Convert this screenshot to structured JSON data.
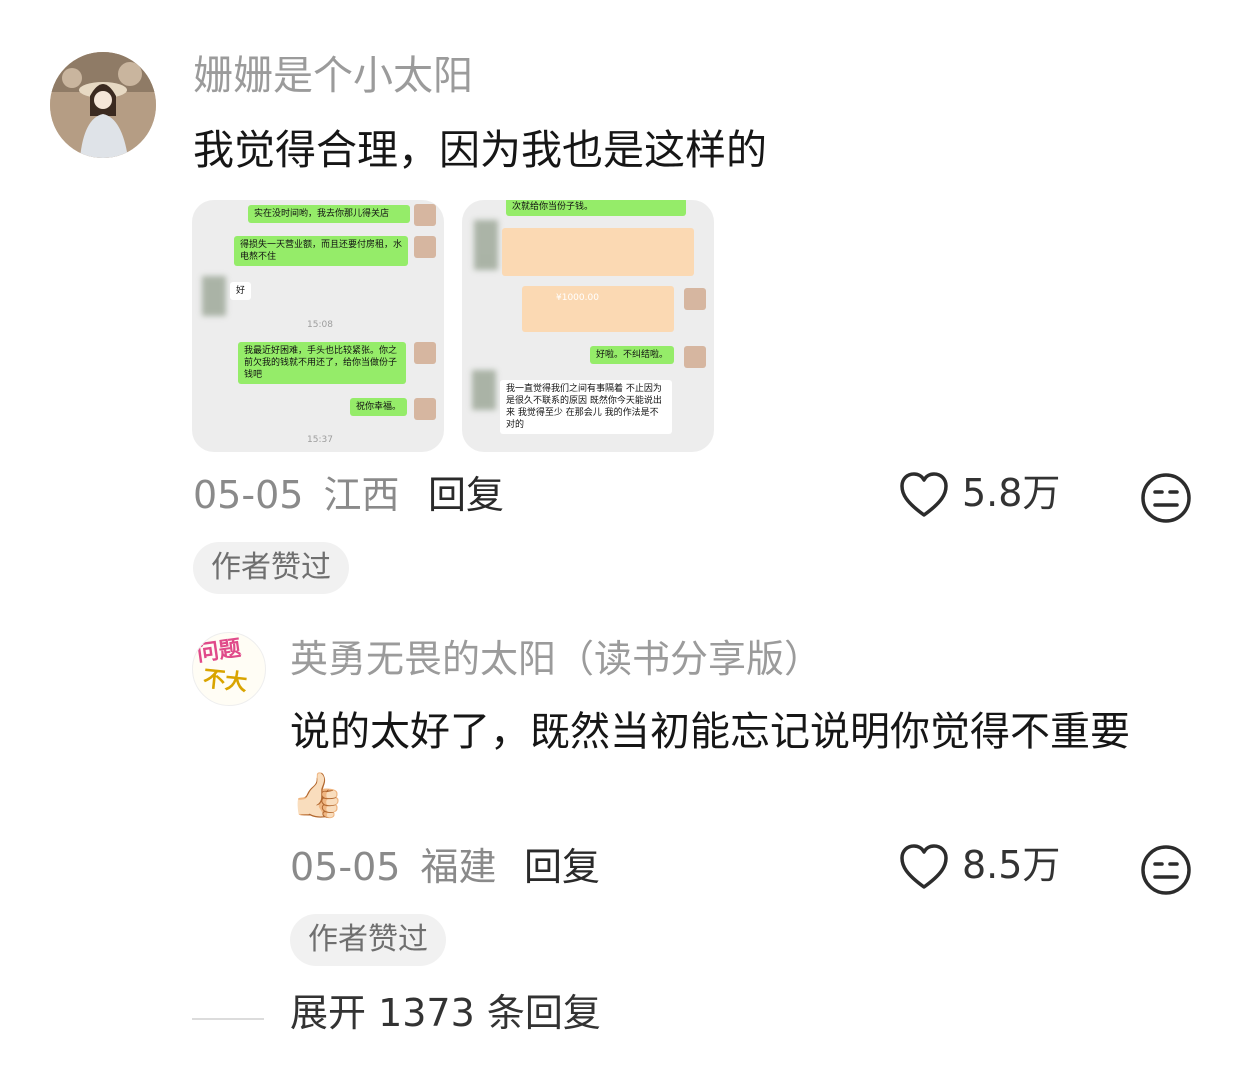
{
  "comments": [
    {
      "username": "姗姗是个小太阳",
      "text": "我觉得合理，因为我也是这样的",
      "date": "05-05",
      "location": "江西",
      "reply_label": "回复",
      "likes": "5.8万",
      "badge": "作者赞过",
      "images": [
        {
          "messages": [
            "实在没时间哟，我去你那儿得关店",
            "得损失一天营业额，而且还要付房租，水电熬不住",
            "好",
            "15:08",
            "我最近好困难，手头也比较紧张。你之前欠我的钱就不用还了，给你当做份子钱吧",
            "祝你幸福。",
            "15:37"
          ]
        },
        {
          "messages": [
            "次就给你当份子钱。",
            "¥1000.00",
            "好啦。不纠结啦。",
            "我一直觉得我们之间有事隔着 不止因为是很久不联系的原因 既然你今天能说出来 我觉得至少 在那会儿 我的作法是不对的"
          ]
        }
      ]
    },
    {
      "username": "英勇无畏的太阳（读书分享版）",
      "avatar_text": [
        "问题",
        "不大"
      ],
      "text_line1": "说的太好了，既然当初能忘记说明你觉得不重要",
      "emoji": "👍🏻",
      "date": "05-05",
      "location": "福建",
      "reply_label": "回复",
      "likes": "8.5万",
      "badge": "作者赞过"
    }
  ],
  "expand_replies": "展开 1373 条回复",
  "icons": {
    "like": "heart-outline-icon",
    "dislike": "neutral-face-icon"
  },
  "colors": {
    "username": "#9b9b9b",
    "text": "#161616",
    "wechat_green": "#95ec69",
    "badge_bg": "#f1f1f1"
  }
}
